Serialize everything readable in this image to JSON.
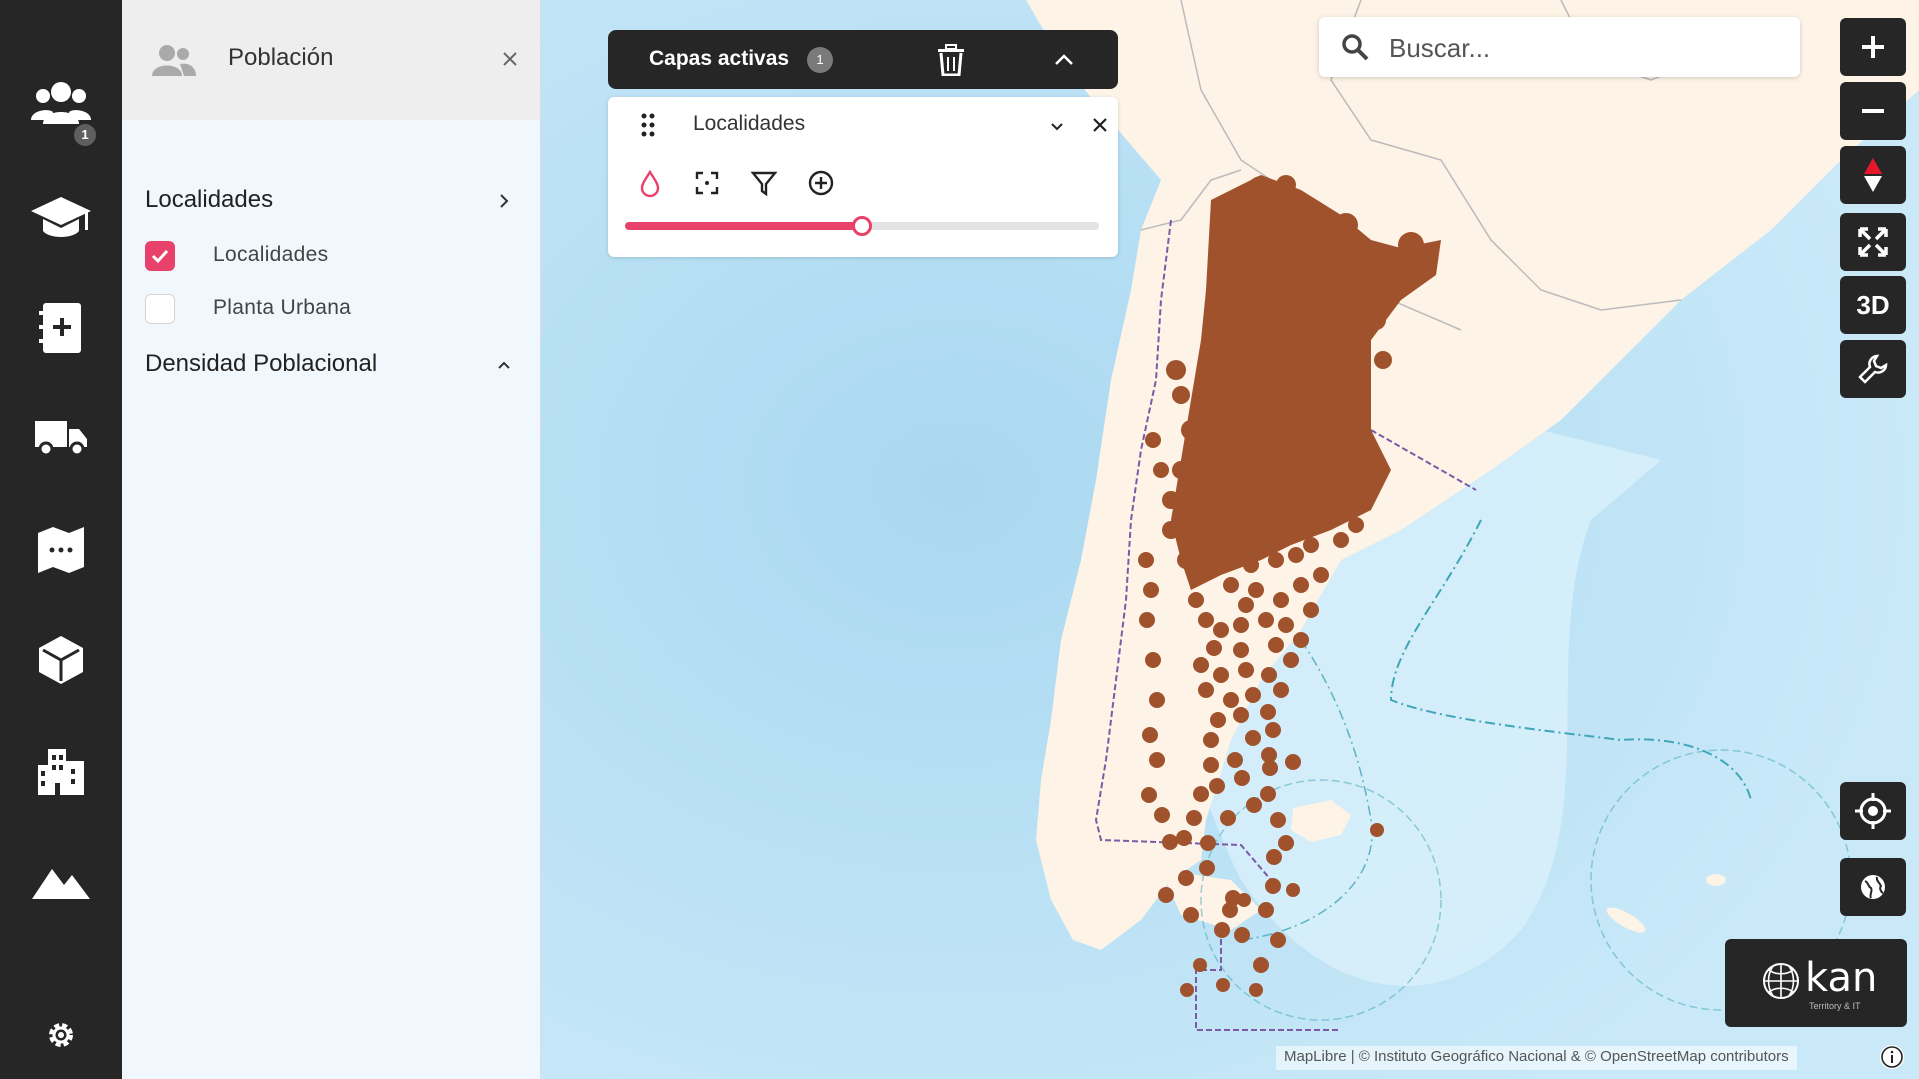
{
  "rail": {
    "users_badge": "1",
    "items": [
      "users-icon",
      "graduation-cap-icon",
      "add-document-icon",
      "truck-icon",
      "map-icon",
      "cube-icon",
      "buildings-icon",
      "mountains-icon"
    ],
    "settings": "gear-icon"
  },
  "panel": {
    "title": "Población",
    "sections": [
      {
        "title": "Localidades",
        "options": [
          {
            "label": "Localidades",
            "checked": true
          },
          {
            "label": "Planta Urbana",
            "checked": false
          }
        ]
      },
      {
        "title": "Densidad Poblacional"
      }
    ]
  },
  "active_layers": {
    "title": "Capas activas",
    "count": "1",
    "layer": {
      "name": "Localidades",
      "opacity": 0.5
    }
  },
  "search": {
    "placeholder": "Buscar..."
  },
  "controls": {
    "three_d": "3D"
  },
  "brand": {
    "name": "kan",
    "tagline": "Territory & IT"
  },
  "attribution": "MapLibre | © Instituto Geográfico Nacional & © OpenStreetMap contributors",
  "colors": {
    "accent": "#e8416a",
    "points": "#a0522d",
    "ocean": "#bfe3f7",
    "land": "#fdf3e7",
    "dark": "#262626"
  }
}
